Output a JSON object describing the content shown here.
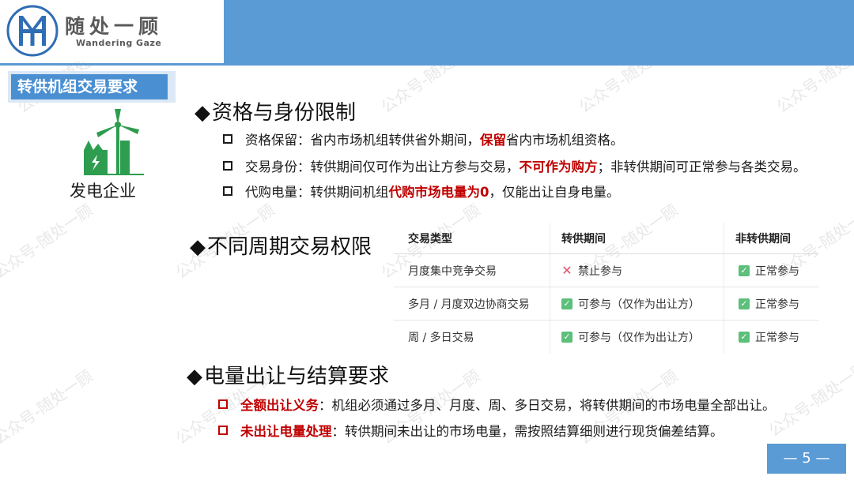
{
  "brand": {
    "cn": "随处一顾",
    "en": "Wandering  Gaze"
  },
  "section_tag": "转供机组交易要求",
  "entity_label": "发电企业",
  "sec1": {
    "title": "资格与身份限制",
    "items": [
      {
        "pre": "资格保留：省内市场机组转供省外期间，",
        "hl": "保留",
        "post": "省内市场机组资格。"
      },
      {
        "pre": "交易身份：转供期间仅可作为出让方参与交易，",
        "hl": "不可作为购方",
        "post": "；非转供期间可正常参与各类交易。"
      },
      {
        "pre": "代购电量：转供期间机组",
        "hl": "代购市场电量为0",
        "post": "，仅能出让自身电量。"
      }
    ]
  },
  "sec2": {
    "title": "不同周期交易权限",
    "table": {
      "headers": [
        "交易类型",
        "转供期间",
        "非转供期间"
      ],
      "rows": [
        {
          "type": "月度集中竞争交易",
          "during": "禁止参与",
          "during_ok": false,
          "other": "正常参与"
        },
        {
          "type": "多月 / 月度双边协商交易",
          "during": "可参与（仅作为出让方）",
          "during_ok": true,
          "other": "正常参与"
        },
        {
          "type": "周 / 多日交易",
          "during": "可参与（仅作为出让方）",
          "during_ok": true,
          "other": "正常参与"
        }
      ]
    }
  },
  "sec3": {
    "title": "电量出让与结算要求",
    "items": [
      {
        "hl": "全额出让义务",
        "post": "：机组必须通过多月、月度、周、多日交易，将转供期间的市场电量全部出让。"
      },
      {
        "hl": "未出让电量处理",
        "post": "：转供期间未出让的市场电量，需按照结算细则进行现货偏差结算。"
      }
    ]
  },
  "page_number": "— 5 —",
  "watermark": "公众号-随处一顾",
  "colors": {
    "accent": "#5b9bd5",
    "highlight": "#c00000",
    "ok": "#5cbf7a",
    "no": "#e0506a"
  }
}
